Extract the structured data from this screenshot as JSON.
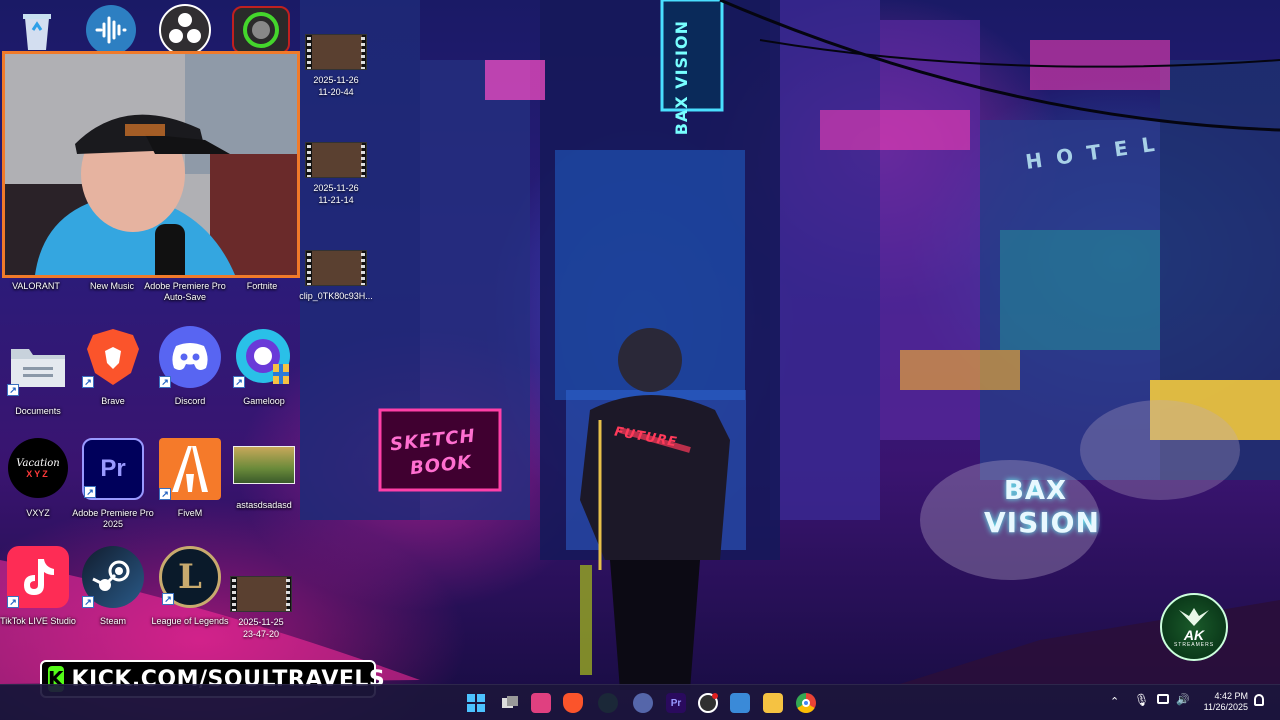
{
  "desktop": {
    "top_row_icons": [
      {
        "name": "recycle-bin-icon"
      },
      {
        "name": "audio-app-icon"
      },
      {
        "name": "obs-studio-icon"
      },
      {
        "name": "razer-app-icon"
      }
    ],
    "video_files": [
      {
        "label_line1": "2025-11-26",
        "label_line2": "11-20-44"
      },
      {
        "label_line1": "2025-11-26",
        "label_line2": "11-21-14"
      },
      {
        "label_line1": "clip_0TK80c93H...",
        "label_line2": ""
      },
      {
        "label_line1": "2025-11-25",
        "label_line2": "23-47-20"
      }
    ],
    "row_labels": [
      "VALORANT",
      "New Music",
      "Adobe Premiere Pro Auto-Save",
      "Fortnite"
    ],
    "icons": [
      {
        "label": "Documents",
        "icon": "folder-icon"
      },
      {
        "label": "Brave",
        "icon": "brave-lion-icon"
      },
      {
        "label": "Discord",
        "icon": "discord-icon"
      },
      {
        "label": "Gameloop",
        "icon": "gameloop-icon"
      },
      {
        "label": "VXYZ",
        "icon": "vacation-xyz-icon",
        "img_text_1": "Vacation",
        "img_text_2": "XYZ"
      },
      {
        "label": "Adobe Premiere Pro 2025",
        "icon": "premiere-pro-icon",
        "img_text": "Pr"
      },
      {
        "label": "FiveM",
        "icon": "fivem-icon"
      },
      {
        "label": "astasdsadasd",
        "icon": "image-file-icon"
      },
      {
        "label": "TikTok LIVE Studio",
        "icon": "tiktok-icon"
      },
      {
        "label": "Steam",
        "icon": "steam-icon"
      },
      {
        "label": "League of Legends",
        "icon": "league-of-legends-icon",
        "img_text": "L"
      }
    ]
  },
  "wallpaper_text": {
    "sign_vertical": "BAX VISION",
    "sign_hotel": "HOTEL",
    "sketch": "SKETCH",
    "book": "BOOK",
    "bax": "BAX",
    "vision": "VISION",
    "future": "FUTURE"
  },
  "overlay": {
    "kick_logo": "K",
    "kick_url": "KICK.COM/SOULTRAVELS",
    "badge_title": "AK",
    "badge_sub": "STREAMERS"
  },
  "taskbar": {
    "pinned": [
      {
        "name": "start-button",
        "color": "#4cc2ff"
      },
      {
        "name": "task-view-button",
        "color": "#dddddd"
      },
      {
        "name": "snipping-tool-icon",
        "color": "#e04080"
      },
      {
        "name": "brave-taskbar-icon",
        "color": "#fb542b"
      },
      {
        "name": "steam-taskbar-icon",
        "color": "#1b2838"
      },
      {
        "name": "keyboard-app-icon",
        "color": "#5566aa"
      },
      {
        "name": "premiere-taskbar-icon",
        "color": "#2a0a5e",
        "text": "Pr"
      },
      {
        "name": "obs-taskbar-icon",
        "color": "#303030"
      },
      {
        "name": "photos-icon",
        "color": "#3a8ad8"
      },
      {
        "name": "file-explorer-icon",
        "color": "#f5c242"
      },
      {
        "name": "chrome-icon",
        "color": "#34a853"
      }
    ],
    "clock_time": "4:42 PM",
    "clock_date": "11/26/2025"
  }
}
